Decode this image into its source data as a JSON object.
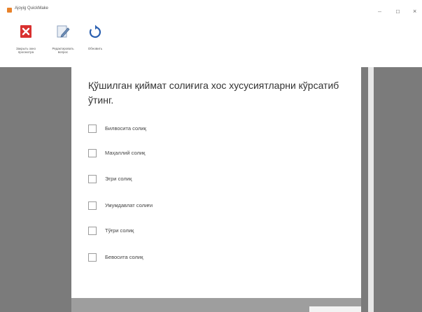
{
  "window": {
    "title": "Ajoyig QuickMake",
    "minimize": "–",
    "maximize": "□",
    "close": "×"
  },
  "toolbar": {
    "buttons": [
      {
        "label": "Закрыть окно просмотра",
        "icon": "close-preview-icon"
      },
      {
        "label": "Редактировать вопрос",
        "icon": "edit-icon"
      },
      {
        "label": "Обновить",
        "icon": "refresh-icon"
      }
    ]
  },
  "colors": {
    "viewer_bg": "#7b7b7b",
    "close_icon": "#d9302f",
    "refresh_icon": "#2a5fb0",
    "app_icon": "#e8822a"
  },
  "question": {
    "text": "Қўшилган қиймат солиғига хос хусусиятларни кўрсатиб ўтинг.",
    "options": [
      {
        "label": "Билвосита солиқ",
        "checked": false
      },
      {
        "label": "Маҳаллий солиқ",
        "checked": false
      },
      {
        "label": "Эгри солиқ",
        "checked": false
      },
      {
        "label": "Умумдавлат солиғи",
        "checked": false
      },
      {
        "label": "Тўғри солиқ",
        "checked": false
      },
      {
        "label": "Бевосита солиқ",
        "checked": false
      }
    ]
  }
}
